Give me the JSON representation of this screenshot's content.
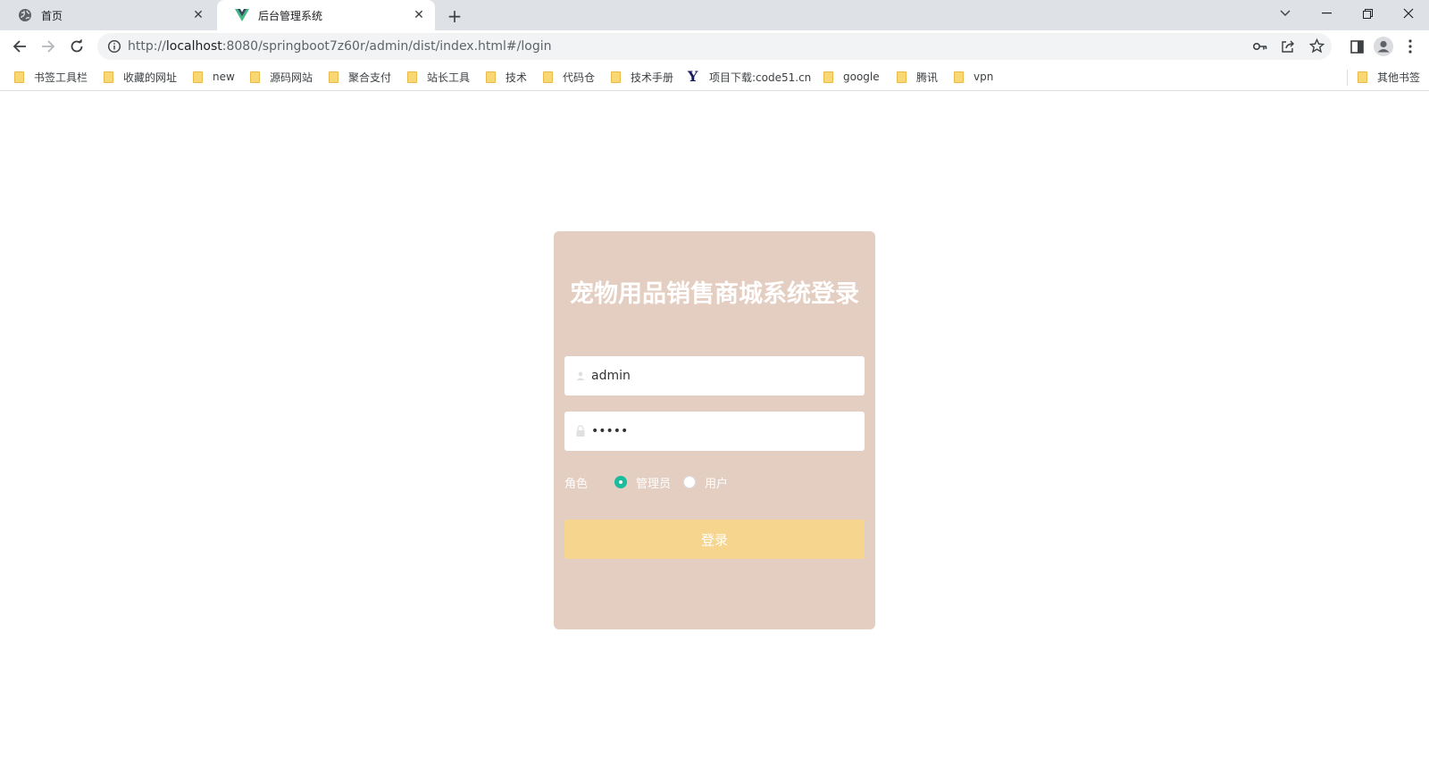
{
  "browser": {
    "tabs": [
      {
        "title": "首页",
        "icon": "globe-icon",
        "active": false
      },
      {
        "title": "后台管理系统",
        "icon": "vue-logo-icon",
        "active": true
      }
    ],
    "address": {
      "scheme": "http://",
      "host": "localhost",
      "rest": ":8080/springboot7z60r/admin/dist/index.html#/login"
    },
    "bookmarks": [
      {
        "label": "书签工具栏",
        "icon": "folder-icon"
      },
      {
        "label": "收藏的网址",
        "icon": "folder-icon"
      },
      {
        "label": "new",
        "icon": "folder-icon"
      },
      {
        "label": "源码网站",
        "icon": "folder-icon"
      },
      {
        "label": "聚合支付",
        "icon": "folder-icon"
      },
      {
        "label": "站长工具",
        "icon": "folder-icon"
      },
      {
        "label": "技术",
        "icon": "folder-icon"
      },
      {
        "label": "代码仓",
        "icon": "folder-icon"
      },
      {
        "label": "技术手册",
        "icon": "folder-icon"
      },
      {
        "label": "项目下载:code51.cn",
        "icon": "site-logo-icon"
      },
      {
        "label": "google",
        "icon": "folder-icon"
      },
      {
        "label": "腾讯",
        "icon": "folder-icon"
      },
      {
        "label": "vpn",
        "icon": "folder-icon"
      }
    ],
    "other_bookmarks": "其他书签"
  },
  "login": {
    "title": "宠物用品销售商城系统登录",
    "username_value": "admin",
    "password_value": "•••••",
    "role_label": "角色",
    "roles": [
      {
        "label": "管理员",
        "selected": true
      },
      {
        "label": "用户",
        "selected": false
      }
    ],
    "submit_label": "登录"
  },
  "colors": {
    "card_bg": "#e4cdc1",
    "button_bg": "#f6d58f",
    "radio_selected": "#1abc9c"
  }
}
